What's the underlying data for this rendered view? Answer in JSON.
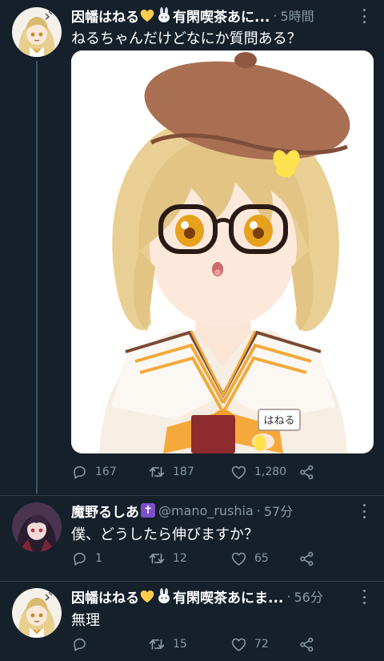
{
  "tweets": [
    {
      "name": "因幡はねる",
      "suffix": "有閑喫茶あに...",
      "time": "5時間",
      "text": "ねるちゃんだけどなにか質問ある？",
      "name_tag": "はねる",
      "replies": "167",
      "retweets": "187",
      "likes": "1,280"
    },
    {
      "name": "魔野るしあ",
      "badge": "✝",
      "handle": "@mano_rushia",
      "time": "57分",
      "text": "僕、どうしたら伸びますか？",
      "replies": "1",
      "retweets": "12",
      "likes": "65"
    },
    {
      "name": "因幡はねる",
      "suffix": "有閑喫茶あにま...",
      "time": "56分",
      "text": "無理",
      "replies": "",
      "retweets": "15",
      "likes": "72"
    }
  ],
  "colors": {
    "background": "#15202b",
    "muted": "#8899a6",
    "thread_line": "#3d5466",
    "separator": "#2f3d4b"
  },
  "icons": {
    "reply": "reply-icon",
    "retweet": "retweet-icon",
    "like": "heart-icon",
    "share": "share-icon",
    "more": "more-icon"
  }
}
